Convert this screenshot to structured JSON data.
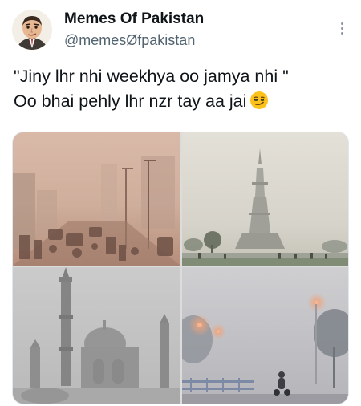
{
  "tweet": {
    "author": {
      "display_name": "Memes Of Pakistan",
      "handle": "@memesØfpakistan"
    },
    "text_lines": [
      "\"Jiny lhr nhi weekhya oo jamya nhi \"",
      "Oo bhai pehly lhr nzr tay aa jai"
    ],
    "emoji": "smirking-face"
  },
  "media": {
    "photos": [
      {
        "subject": "smoggy-street-traffic"
      },
      {
        "subject": "minar-e-pakistan-in-smog"
      },
      {
        "subject": "badshahi-mosque-in-smog"
      },
      {
        "subject": "foggy-road-streetlights-motorcyclist"
      }
    ]
  },
  "colors": {
    "name": "#0f1419",
    "handle": "#536471",
    "text": "#0f1419"
  }
}
